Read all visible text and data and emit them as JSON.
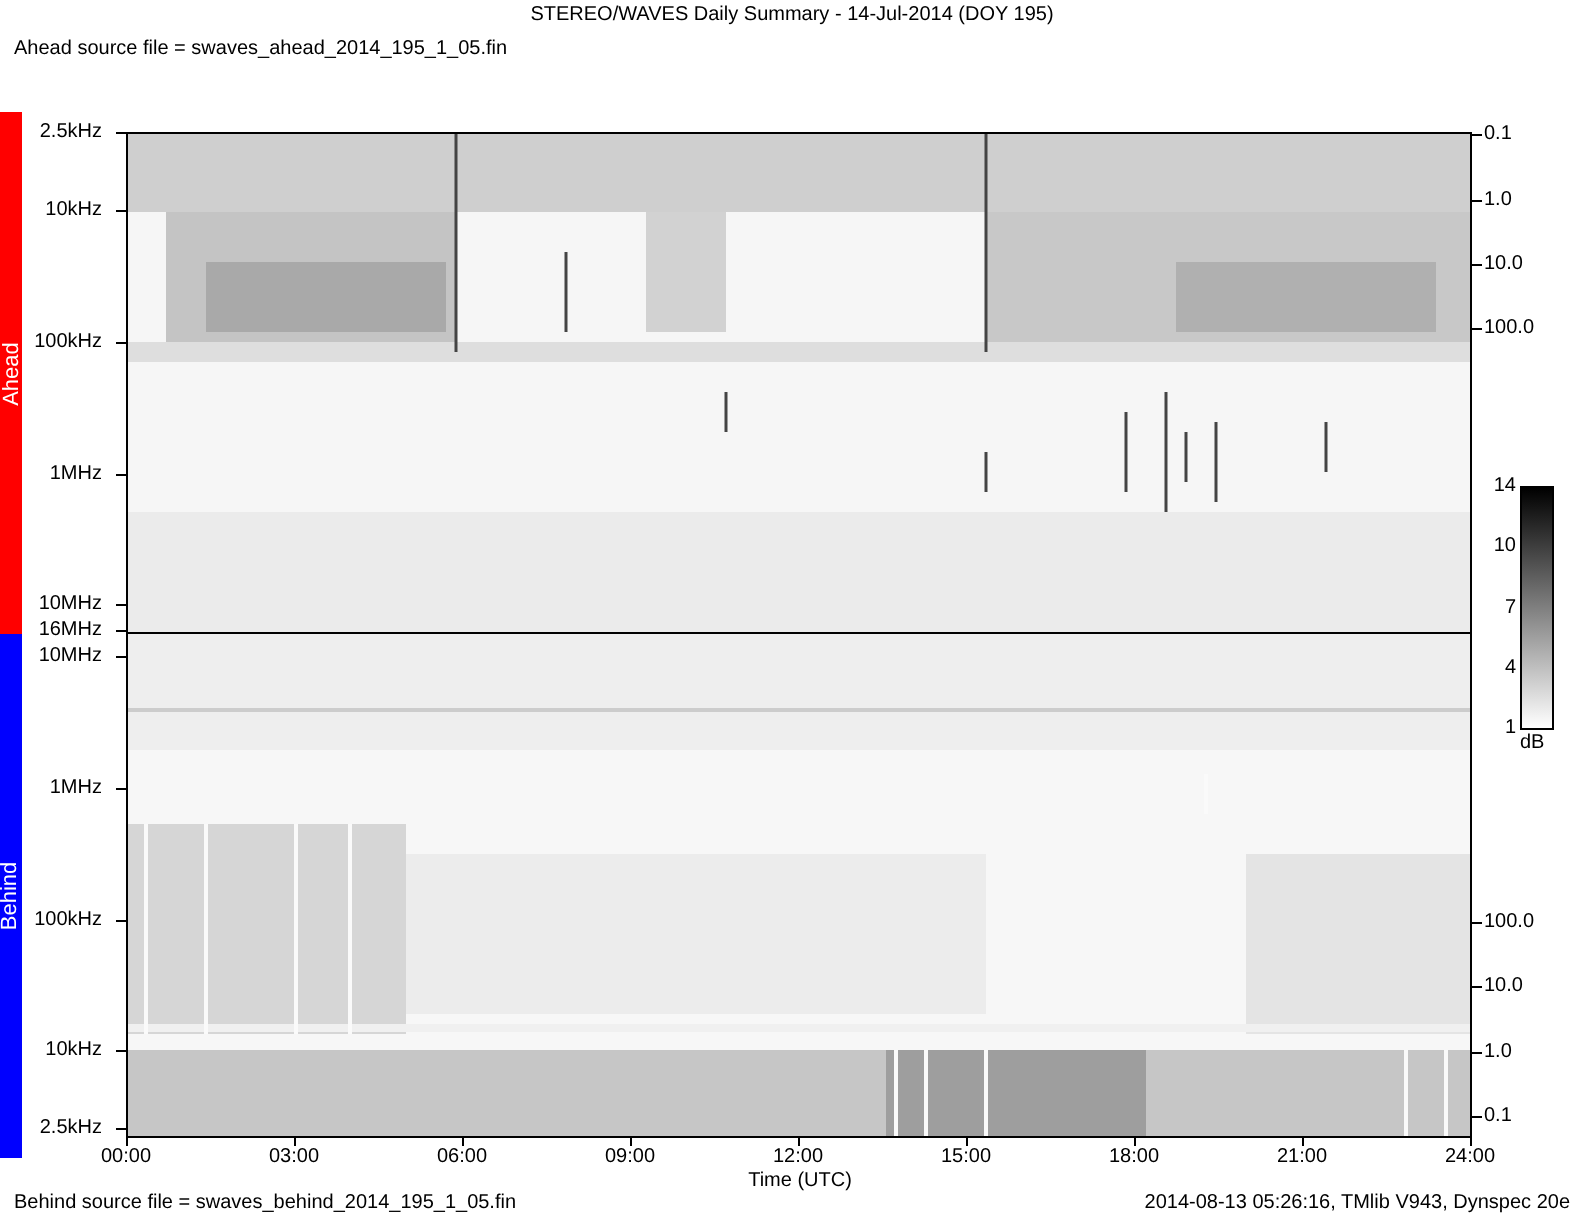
{
  "title": "STEREO/WAVES Daily Summary - 14-Jul-2014 (DOY 195)",
  "ahead_source": "Ahead source file = swaves_ahead_2014_195_1_05.fin",
  "panels": [
    {
      "label": "Ahead",
      "color": "#ff0000",
      "frequency_ticks": [
        "2.5kHz",
        "10kHz",
        "100kHz",
        "1MHz",
        "10MHz",
        "16MHz"
      ],
      "flux_ticks": [
        "0.1",
        "1.0",
        "10.0",
        "100.0"
      ]
    },
    {
      "label": "Behind",
      "color": "#0000ff",
      "frequency_ticks": [
        "10MHz",
        "1MHz",
        "100kHz",
        "10kHz",
        "2.5kHz"
      ],
      "flux_ticks": [
        "100.0",
        "10.0",
        "1.0",
        "0.1"
      ]
    }
  ],
  "time_ticks": [
    "00:00",
    "03:00",
    "06:00",
    "09:00",
    "12:00",
    "15:00",
    "18:00",
    "21:00",
    "24:00"
  ],
  "xlabel": "Time (UTC)",
  "colorbar": {
    "ticks": [
      "14",
      "10",
      "7",
      "4",
      "1"
    ],
    "unit": "dB"
  },
  "behind_source": "Behind source file = swaves_behind_2014_195_1_05.fin",
  "footer_note": "2014-08-13 05:26:16, TMlib V943, Dynspec 20e"
}
